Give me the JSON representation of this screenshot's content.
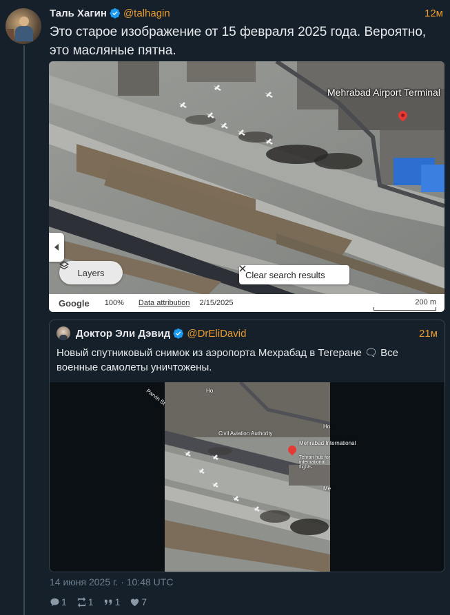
{
  "tweet": {
    "author_name": "Таль Хагин",
    "author_handle": "@talhagin",
    "time_ago": "12м",
    "text": "Это старое изображение от 15 февраля 2025 года. Вероятно, это масляные пятна.",
    "verified_icon": "verified-badge-icon",
    "timestamp": "14 июня 2025 г. · 10:48 UTC",
    "counts": {
      "replies": "1",
      "retweets": "1",
      "quotes": "1",
      "likes": "7"
    }
  },
  "map": {
    "terminal_label": "Mehrabad Airport Terminal",
    "layers_label": "Layers",
    "clear_label": "Clear search results",
    "google_label": "Google",
    "zoom_label": "100%",
    "attribution_label": "Data attribution",
    "date_label": "2/15/2025",
    "scale_label": "200 m"
  },
  "quote": {
    "author_name": "Доктор Эли Дэвид",
    "author_handle": "@DrEliDavid",
    "time_ago": "21м",
    "text": "Новый спутниковый снимок из аэропорта Мехрабад в Тегеране 🗨 Все военные самолеты уничтожены.",
    "image_labels": {
      "civil_aviation": "Civil Aviation Authority",
      "mehrabad": "Mehrabad International",
      "tehran_hub": "Tehran hub for international flights",
      "parvin": "Parvin St",
      "ho_top": "Ho",
      "ho_mid": "Ho",
      "me": "Me"
    }
  },
  "colors": {
    "accent": "#ea9b2c",
    "background": "#15202b",
    "text": "#e7e9ea",
    "muted": "#6e7f8f"
  }
}
